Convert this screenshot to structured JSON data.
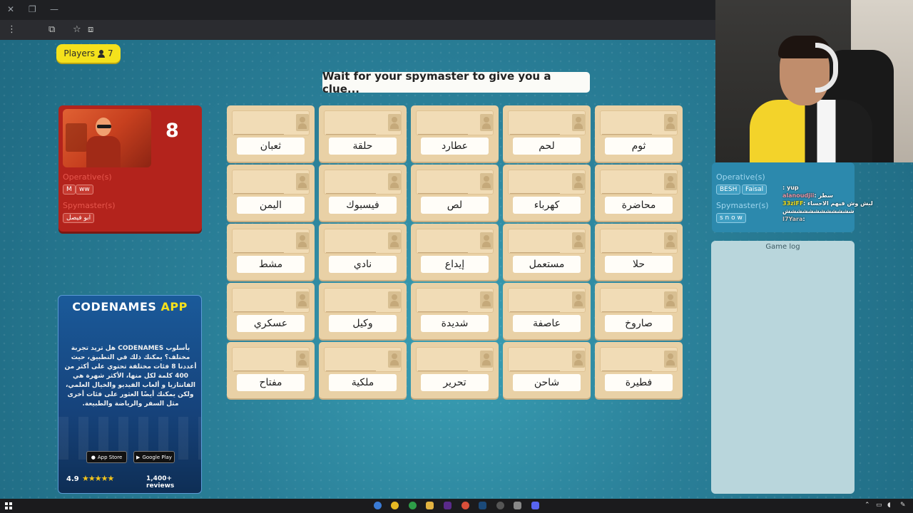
{
  "browser": {
    "url": "codenames",
    "profile_initial": "M"
  },
  "players_button": {
    "label": "Players",
    "count": "7"
  },
  "clue_banner": "Wait for your spymaster to give you a clue...",
  "red_team": {
    "cards_left": "8",
    "operatives_label": "Operative(s)",
    "operatives": [
      "M",
      "ww"
    ],
    "spymaster_label": "Spymaster(s)",
    "spymasters": [
      "ابو فيصل"
    ]
  },
  "blue_team": {
    "operatives_label": "Operative(s)",
    "operatives": [
      "BESH",
      "Faisal"
    ],
    "spymaster_label": "Spymaster(s)",
    "spymasters": [
      "s n o w"
    ]
  },
  "game_log_title": "Game log",
  "board": [
    [
      "ثعبان",
      "حلقة",
      "عطارد",
      "لحم",
      "ثوم"
    ],
    [
      "اليمن",
      "فيسبوك",
      "لص",
      "كهرباء",
      "محاضرة"
    ],
    [
      "مشط",
      "نادي",
      "إيداع",
      "مستعمل",
      "حلا"
    ],
    [
      "عسكري",
      "وكيل",
      "شديدة",
      "عاصفة",
      "صاروخ"
    ],
    [
      "مفتاح",
      "ملكية",
      "تحرير",
      "شاحن",
      "فطيرة"
    ]
  ],
  "ad": {
    "title_main": "CODENAMES",
    "title_accent": "APP",
    "body": "بأسلوب CODENAMES هل تريد تجربة مختلف؟ يمكنك ذلك في التطبيق، حيث أعددنا 8 فئات مختلفة تحتوي على أكثر من 400 كلمة لكل منها، الأكثر شهرة هي الفانتازيا و ألعاب الفيديو والخيال العلمي، ولكن يمكنك أيضًا العثور على فئات أخرى مثل السفر والرياضة والطبيعة.",
    "app_store": "App Store",
    "google_play": "Google Play",
    "rating": "4.9",
    "stars": "★★★★★",
    "reviews": "1,400+ reviews"
  },
  "chat": [
    {
      "user": "",
      "text": ": yup"
    },
    {
      "user": "alanoudjii",
      "text": ": سطر"
    },
    {
      "user": "33ziFF",
      "text": ": لبش وش فيهم الاحساء"
    },
    {
      "user": "",
      "text": "شششششششششششش"
    },
    {
      "user": "I7Yara",
      "text": ":"
    }
  ],
  "colors": {
    "red_team": "#b3231c",
    "card": "#e9d1a6",
    "players_button": "#f4e11c",
    "board_bg": "#2a7f98"
  }
}
